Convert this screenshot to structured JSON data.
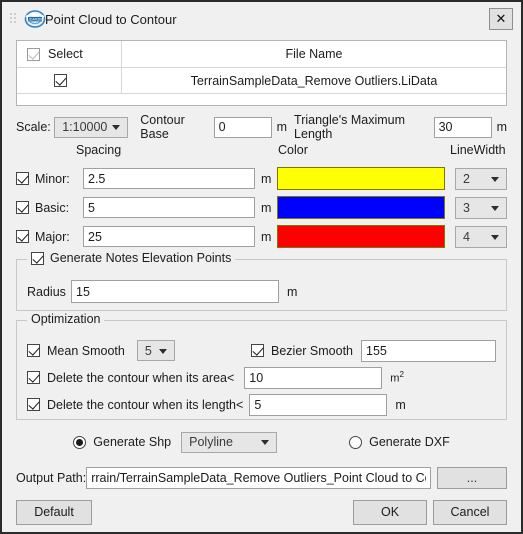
{
  "window": {
    "title": "Point Cloud to Contour",
    "logo_icon": "lidar360-logo-icon",
    "grip_icon": "drag-grip-icon",
    "close_label": "✕"
  },
  "file_table": {
    "headers": {
      "select": "Select",
      "file_name": "File Name"
    },
    "header_select_checked": true,
    "rows": [
      {
        "selected": true,
        "file_name": "TerrainSampleData_Remove Outliers.LiData"
      }
    ]
  },
  "scale_row": {
    "scale_label": "Scale:",
    "scale_value": "1:10000",
    "contour_base_label": "Contour Base",
    "contour_base_value": "0",
    "contour_base_unit": "m",
    "triangle_label": "Triangle's Maximum Length",
    "triangle_value": "30",
    "triangle_unit": "m"
  },
  "columns": {
    "spacing": "Spacing",
    "color": "Color",
    "linewidth": "LineWidth"
  },
  "levels": [
    {
      "label": "Minor:",
      "checked": true,
      "spacing": "2.5",
      "unit": "m",
      "color": "#FFFF00",
      "linewidth": "2"
    },
    {
      "label": "Basic:",
      "checked": true,
      "spacing": "5",
      "unit": "m",
      "color": "#0000FF",
      "linewidth": "3"
    },
    {
      "label": "Major:",
      "checked": true,
      "spacing": "25",
      "unit": "m",
      "color": "#FF0000",
      "linewidth": "4"
    }
  ],
  "notes_group": {
    "title": "Generate Notes Elevation Points",
    "checked": true,
    "radius_label": "Radius",
    "radius_value": "15",
    "radius_unit": "m"
  },
  "optimization": {
    "title": "Optimization",
    "mean_smooth_label": "Mean Smooth",
    "mean_smooth_checked": true,
    "mean_smooth_value": "5",
    "bezier_smooth_label": "Bezier Smooth",
    "bezier_smooth_checked": true,
    "bezier_smooth_value": "155",
    "area_label": "Delete the contour when its area<",
    "area_checked": true,
    "area_value": "10",
    "area_unit_base": "m",
    "area_unit_sup": "2",
    "length_label": "Delete the contour when its length<",
    "length_checked": true,
    "length_value": "5",
    "length_unit": "m"
  },
  "output_format": {
    "shp_label": "Generate Shp",
    "shp_selected": true,
    "shp_type_value": "Polyline",
    "dxf_label": "Generate DXF",
    "dxf_selected": false
  },
  "output_path": {
    "label": "Output Path:",
    "value": "rrain/TerrainSampleData_Remove Outliers_Point Cloud to Contour.shp",
    "browse_label": "..."
  },
  "footer": {
    "default_label": "Default",
    "ok_label": "OK",
    "cancel_label": "Cancel"
  }
}
